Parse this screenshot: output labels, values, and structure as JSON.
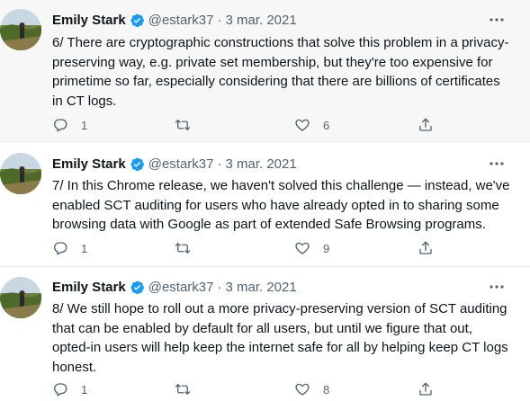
{
  "colors": {
    "verified_badge": "#1d9bf0",
    "icon_gray": "#536471",
    "text": "#0f1419",
    "hover_background": "#f7f7f7"
  },
  "tweets": [
    {
      "author_name": "Emily Stark",
      "handle": "@estark37",
      "separator": "·",
      "date": "3 mar. 2021",
      "text": "6/ There are cryptographic constructions that solve this problem in a privacy-preserving way, e.g. private set membership, but they're too expensive for primetime so far, especially considering that there are billions of certificates in CT logs.",
      "reply_count": "1",
      "retweet_count": "",
      "like_count": "6"
    },
    {
      "author_name": "Emily Stark",
      "handle": "@estark37",
      "separator": "·",
      "date": "3 mar. 2021",
      "text": "7/ In this Chrome release, we haven't solved this challenge — instead, we've enabled SCT auditing for users who have already opted in to sharing some browsing data with Google as part of extended Safe Browsing programs.",
      "reply_count": "1",
      "retweet_count": "",
      "like_count": "9"
    },
    {
      "author_name": "Emily Stark",
      "handle": "@estark37",
      "separator": "·",
      "date": "3 mar. 2021",
      "text": "8/ We still hope to roll out a more privacy-preserving version of SCT auditing that can be enabled by default for all users, but until we figure that out, opted-in users will help keep the internet safe for all by helping keep CT logs honest.",
      "reply_count": "1",
      "retweet_count": "",
      "like_count": "8"
    }
  ],
  "icons": {
    "avatar": "profile-photo",
    "verified": "verified-badge-icon",
    "more": "more-horizontal-icon",
    "reply": "reply-icon",
    "retweet": "retweet-icon",
    "like": "heart-icon",
    "share": "share-icon"
  }
}
